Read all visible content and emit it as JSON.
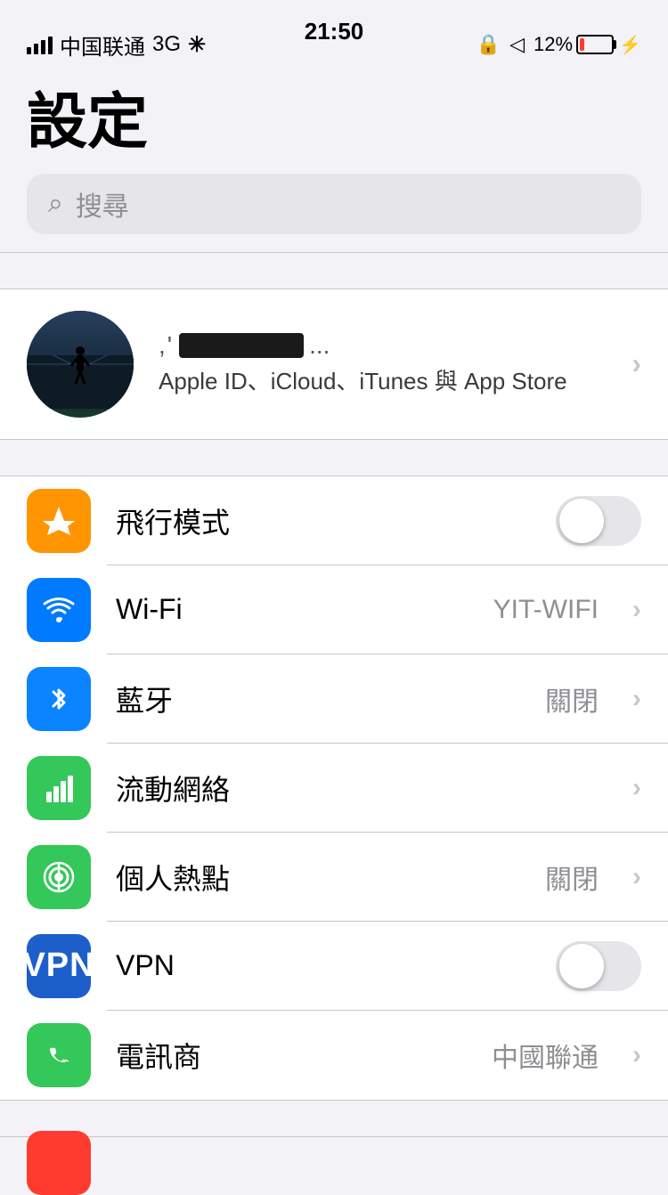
{
  "statusBar": {
    "carrier": "中国联通",
    "network": "3G",
    "time": "21:50",
    "batteryPercent": "12%"
  },
  "page": {
    "title": "設定",
    "searchPlaceholder": "搜尋"
  },
  "appleId": {
    "subtitle": "Apple ID、iCloud、iTunes 與 App Store",
    "chevron": "›"
  },
  "settings": [
    {
      "id": "airplane",
      "label": "飛行模式",
      "iconColor": "icon-orange",
      "iconType": "airplane",
      "hasToggle": true,
      "toggleOn": false,
      "value": "",
      "hasChevron": false
    },
    {
      "id": "wifi",
      "label": "Wi-Fi",
      "iconColor": "icon-blue",
      "iconType": "wifi",
      "hasToggle": false,
      "value": "YIT-WIFI",
      "hasChevron": true
    },
    {
      "id": "bluetooth",
      "label": "藍牙",
      "iconColor": "icon-blue-dark",
      "iconType": "bluetooth",
      "hasToggle": false,
      "value": "關閉",
      "hasChevron": true
    },
    {
      "id": "cellular",
      "label": "流動網絡",
      "iconColor": "icon-green",
      "iconType": "cellular",
      "hasToggle": false,
      "value": "",
      "hasChevron": true
    },
    {
      "id": "hotspot",
      "label": "個人熱點",
      "iconColor": "icon-green",
      "iconType": "hotspot",
      "hasToggle": false,
      "value": "關閉",
      "hasChevron": true
    },
    {
      "id": "vpn",
      "label": "VPN",
      "iconColor": "icon-vpn",
      "iconType": "vpn",
      "hasToggle": true,
      "toggleOn": false,
      "value": "",
      "hasChevron": false
    },
    {
      "id": "carrier",
      "label": "電訊商",
      "iconColor": "icon-green",
      "iconType": "phone",
      "hasToggle": false,
      "value": "中國聯通",
      "hasChevron": true
    }
  ]
}
